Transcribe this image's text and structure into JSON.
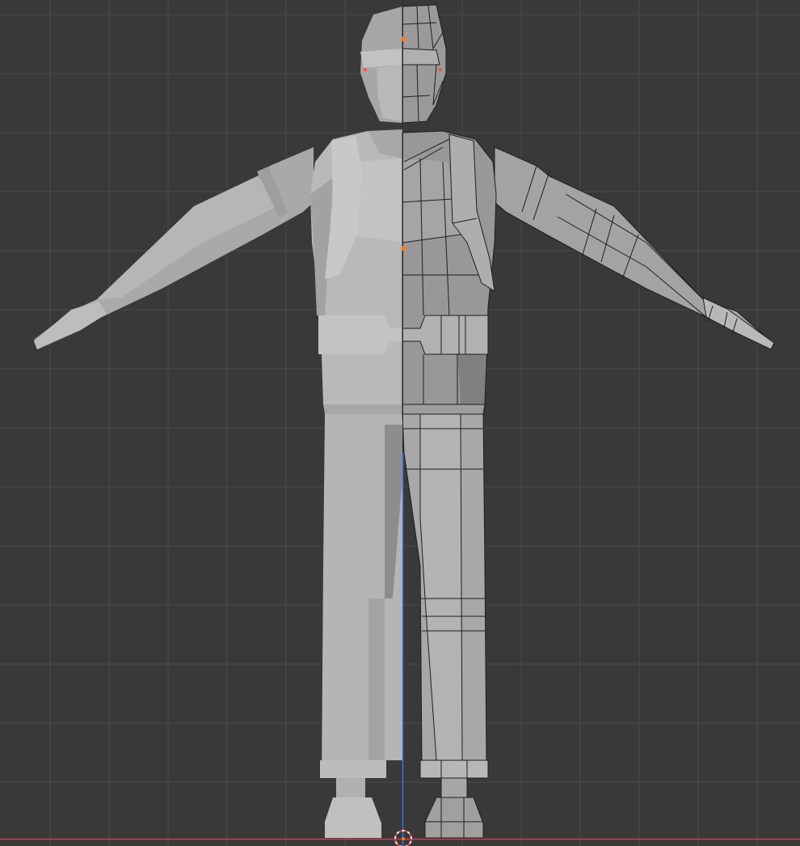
{
  "viewport": {
    "mode": "front-orthographic",
    "background_color": "#393939",
    "grid_color": "#4a4a4a",
    "x_axis_color": "#d43a4a",
    "z_axis_color": "#3f78c8",
    "origin_marker_color": "#ff7a1a",
    "cursor_colors": [
      "#e14a4a",
      "#ffffff"
    ]
  },
  "model": {
    "name": "",
    "shading": "solid",
    "left_half_color": "#b4b4b4",
    "right_half_color": "#9c9c9c",
    "wireframe_color": "#1e1e1e",
    "mirror_modifier": true
  }
}
